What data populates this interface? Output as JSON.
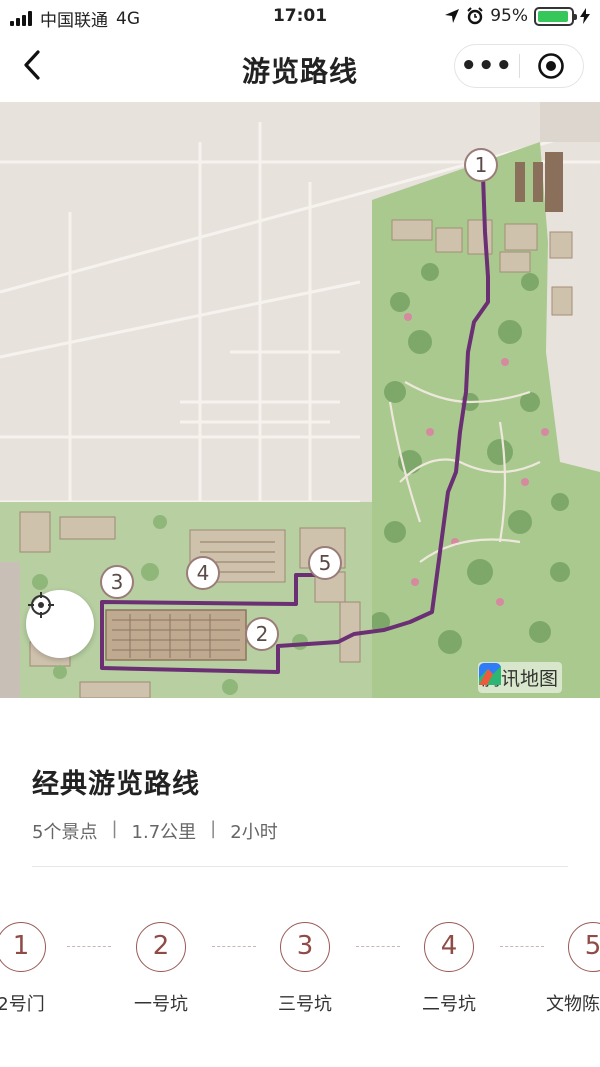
{
  "status_bar": {
    "carrier": "中国联通",
    "network": "4G",
    "time": "17:01",
    "battery": "95%",
    "battery_level": 0.95
  },
  "nav": {
    "back_icon": "chevron-left-icon",
    "title": "游览路线",
    "more_icon": "more-dots-icon",
    "more_label": "•••",
    "close_icon": "target-circle-icon"
  },
  "map": {
    "route_color": "#6b2f74",
    "markers": [
      "1",
      "2",
      "3",
      "4",
      "5"
    ],
    "provider_label": "腾讯地图",
    "locate_icon": "crosshair-icon"
  },
  "route": {
    "title": "经典游览路线",
    "spots": "5个景点",
    "distance": "1.7公里",
    "duration": "2小时",
    "separator": "|"
  },
  "stops": [
    {
      "num": "1",
      "name": "2号门"
    },
    {
      "num": "2",
      "name": "一号坑"
    },
    {
      "num": "3",
      "name": "三号坑"
    },
    {
      "num": "4",
      "name": "二号坑"
    },
    {
      "num": "5",
      "name": "文物陈"
    }
  ],
  "colors": {
    "accent": "#8f4c47",
    "route": "#6b2f74",
    "park_green": "#a9c98f"
  }
}
